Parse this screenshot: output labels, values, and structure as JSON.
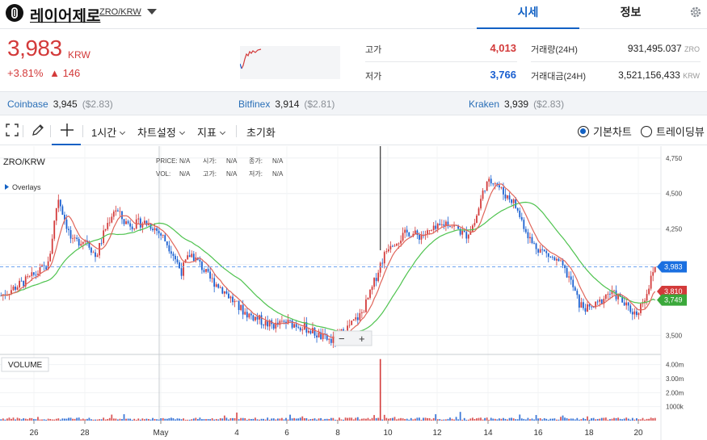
{
  "header": {
    "coin_name": "레이어제로",
    "pair_link": "ZRO/KRW",
    "tabs": [
      {
        "label": "시세"
      },
      {
        "label": "정보"
      }
    ]
  },
  "price": {
    "value": "3,983",
    "unit": "KRW",
    "change_percent": "+3.81%",
    "change_arrow": "▲",
    "change_amount": "146"
  },
  "stats": {
    "high_label": "고가",
    "high_value": "4,013",
    "low_label": "저가",
    "low_value": "3,766",
    "volume_label": "거래량(24H)",
    "volume_value": "931,495.037",
    "volume_unit": "ZRO",
    "amount_label": "거래대금(24H)",
    "amount_value": "3,521,156,433",
    "amount_unit": "KRW"
  },
  "exchanges": [
    {
      "name": "Coinbase",
      "krw": "3,945",
      "usd": "($2.83)"
    },
    {
      "name": "Bitfinex",
      "krw": "3,914",
      "usd": "($2.81)"
    },
    {
      "name": "Kraken",
      "krw": "3,939",
      "usd": "($2.83)"
    }
  ],
  "toolbar": {
    "interval": "1시간",
    "chart_settings": "차트설정",
    "indicators": "지표",
    "reset": "초기화",
    "basic_chart": "기본차트",
    "trading_view": "트레이딩뷰"
  },
  "colors": {
    "up": "#d33a3a",
    "down": "#1a5fd0",
    "accent": "#1261c4",
    "ma_fast": "#e0655a",
    "ma_slow": "#4fc34f",
    "gray_text": "#8a8f96"
  },
  "chart_data": {
    "type": "candlestick",
    "symbol": "ZRO/KRW",
    "legend": {
      "price_label": "PRICE:",
      "price_value": "N/A",
      "open_label": "시가:",
      "open_value": "N/A",
      "close_label": "종가:",
      "close_value": "N/A",
      "vol_label": "VOL:",
      "vol_value": "N/A",
      "high_label": "고가:",
      "high_value": "N/A",
      "low_label": "저가:",
      "low_value": "N/A"
    },
    "overlays_label": "Overlays",
    "volume_label": "VOLUME",
    "x_ticks": [
      "26",
      "28",
      "May",
      "4",
      "6",
      "8",
      "10",
      "12",
      "14",
      "16",
      "18",
      "20"
    ],
    "y_ticks": [
      3500,
      3750,
      4000,
      4250,
      4500,
      4750
    ],
    "y_tick_labels": [
      "3,500",
      "",
      "",
      "4,250",
      "4,500",
      "4,750"
    ],
    "ylim": [
      3400,
      4800
    ],
    "volume_ticks": [
      "4.00m",
      "3.00m",
      "2.00m",
      "1000k"
    ],
    "volume_tick_values": [
      4000000,
      3000000,
      2000000,
      1000000
    ],
    "last_price": 3983,
    "last_price_label": "3,983",
    "ma_fast_last": 3810,
    "ma_fast_last_label": "3,810",
    "ma_slow_last": 3749,
    "ma_slow_last_label": "3,749",
    "zoom_out_label": "−",
    "zoom_in_label": "+",
    "close_path": [
      [
        0,
        3780
      ],
      [
        6,
        3900
      ],
      [
        10,
        4000
      ],
      [
        12,
        4480
      ],
      [
        15,
        4150
      ],
      [
        18,
        4180
      ],
      [
        20,
        4050
      ],
      [
        22,
        4250
      ],
      [
        24,
        4400
      ],
      [
        26,
        4300
      ],
      [
        28,
        4280
      ],
      [
        30,
        4300
      ],
      [
        32,
        4270
      ],
      [
        34,
        4200
      ],
      [
        36,
        4100
      ],
      [
        38,
        3950
      ],
      [
        40,
        4080
      ],
      [
        42,
        4000
      ],
      [
        44,
        3900
      ],
      [
        46,
        3850
      ],
      [
        48,
        3780
      ],
      [
        50,
        3700
      ],
      [
        52,
        3650
      ],
      [
        54,
        3620
      ],
      [
        56,
        3580
      ],
      [
        58,
        3570
      ],
      [
        60,
        3590
      ],
      [
        62,
        3580
      ],
      [
        64,
        3560
      ],
      [
        66,
        3520
      ],
      [
        68,
        3480
      ],
      [
        70,
        3460
      ],
      [
        72,
        3520
      ],
      [
        74,
        3580
      ],
      [
        76,
        3650
      ],
      [
        78,
        3800
      ],
      [
        80,
        4000
      ],
      [
        82,
        4150
      ],
      [
        84,
        4180
      ],
      [
        86,
        4230
      ],
      [
        88,
        4200
      ],
      [
        90,
        4220
      ],
      [
        92,
        4250
      ],
      [
        94,
        4300
      ],
      [
        96,
        4260
      ],
      [
        98,
        4200
      ],
      [
        100,
        4300
      ],
      [
        102,
        4550
      ],
      [
        104,
        4600
      ],
      [
        106,
        4500
      ],
      [
        108,
        4450
      ],
      [
        110,
        4300
      ],
      [
        112,
        4150
      ],
      [
        114,
        4100
      ],
      [
        116,
        4050
      ],
      [
        118,
        4000
      ],
      [
        120,
        3900
      ],
      [
        122,
        3720
      ],
      [
        124,
        3680
      ],
      [
        126,
        3720
      ],
      [
        128,
        3800
      ],
      [
        130,
        3780
      ],
      [
        132,
        3700
      ],
      [
        134,
        3650
      ],
      [
        136,
        3780
      ],
      [
        138,
        3983
      ]
    ],
    "close_path_domain": [
      0,
      138
    ],
    "volume_spike_index": 80,
    "volume_spike_value": 4400000
  }
}
